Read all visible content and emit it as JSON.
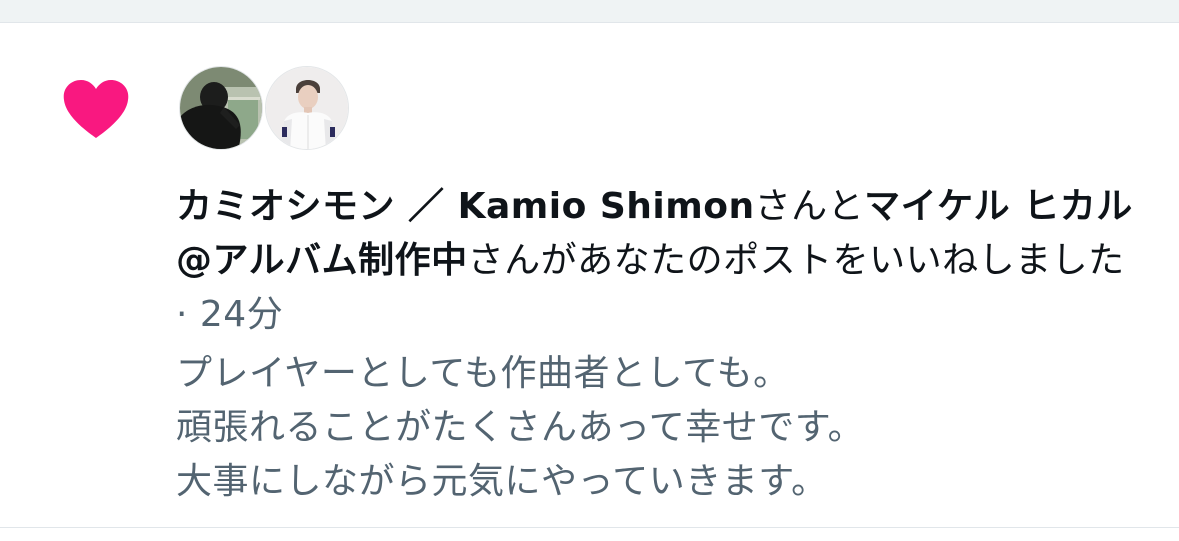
{
  "notification": {
    "type_icon": "heart-icon",
    "accent_color": "#f91880",
    "users": [
      {
        "name": "カミオシモン ／ Kamio Shimon",
        "avatar_icon": "avatar-silhouette"
      },
      {
        "name": "マイケル ヒカル @アルバム制作中",
        "avatar_icon": "avatar-person-white"
      }
    ],
    "connector_1": "さんと",
    "connector_2": "さんがあなたのポストをいいねしました",
    "separator": "·",
    "time": "24分",
    "post_lines": [
      "プレイヤーとしても作曲者としても。",
      "頑張れることがたくさんあって幸せです。",
      "大事にしながら元気にやっていきます。"
    ]
  },
  "colors": {
    "primary_text": "#0f1419",
    "secondary_text": "#536471",
    "divider": "#e1e6ea",
    "background_strip": "#eff3f4"
  }
}
